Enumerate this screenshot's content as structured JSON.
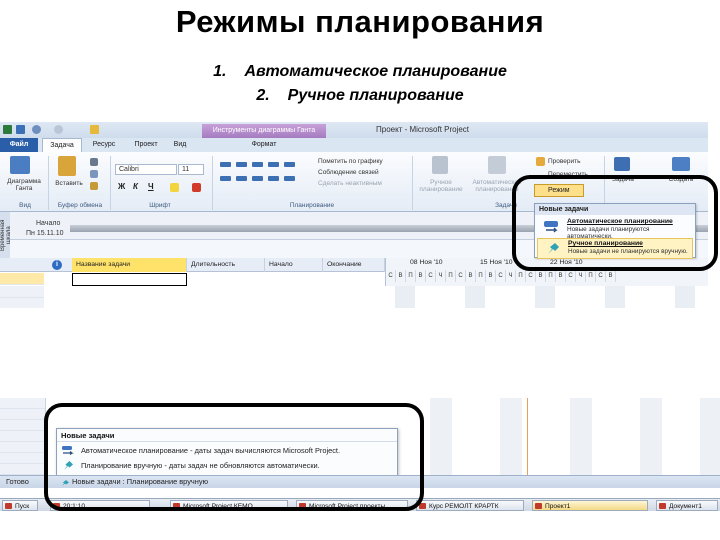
{
  "slide": {
    "title": "Режимы планирования",
    "items": [
      {
        "num": "1.",
        "text": "Автоматическое планирование"
      },
      {
        "num": "2.",
        "text": "Ручное планирование"
      }
    ]
  },
  "app": {
    "window_title": "Проект - Microsoft Project",
    "context_tab": "Инструменты диаграммы Ганта",
    "tabs": [
      "Файл",
      "Задача",
      "Ресурс",
      "Проект",
      "Вид",
      "Формат"
    ],
    "active_tab": "Задача"
  },
  "ribbon": {
    "gantt_label": "Диаграмма Ганта",
    "paste_label": "Вставить",
    "font_name": "Calibri",
    "font_size": "11",
    "bold": "Ж",
    "italic": "К",
    "underline": "Ч",
    "mark_on_track": "Пометить по графику",
    "respect_links": "Соблюдение связей",
    "make_inactive": "Сделать неактивным",
    "manual_schedule": "Ручное планирование",
    "auto_schedule": "Автоматическое планирование",
    "inspect": "Проверить",
    "move": "Переместить",
    "mode": "Режим",
    "task": "Задача",
    "create": "Создать",
    "groups": {
      "view": "Вид",
      "clipboard": "Буфер обмена",
      "font": "Шрифт",
      "schedule": "Планирование",
      "tasks": "Задачи"
    }
  },
  "timeline": {
    "side_label": "Временная шкала",
    "start_label": "Начало",
    "start_date": "Пн 15.11.10"
  },
  "grid": {
    "columns": [
      "Название задачи",
      "Длительность",
      "Начало",
      "Окончание"
    ],
    "weeks": [
      "08 Ноя '10",
      "15 Ноя '10",
      "22 Ноя '10"
    ],
    "days": [
      "С",
      "В",
      "П",
      "В",
      "С",
      "Ч",
      "П",
      "С",
      "В",
      "П",
      "В",
      "С",
      "Ч",
      "П",
      "С",
      "В",
      "П",
      "В",
      "С",
      "Ч",
      "П",
      "С",
      "В"
    ]
  },
  "mode_dropdown": {
    "header": "Новые задачи",
    "items": [
      {
        "title": "Автоматическое планирование",
        "desc": "Новые задачи планируются автоматически."
      },
      {
        "title": "Ручное планирование",
        "desc": "Новые задачи не планируются вручную."
      }
    ]
  },
  "tooltip": {
    "header": "Новые задачи",
    "rows": [
      "Автоматическое планирование - даты задач вычисляются Microsoft Project.",
      "Планирование вручную - даты задач не обновляются автоматически."
    ]
  },
  "status_bar": {
    "ready": "Готово",
    "new_tasks_mode": "Новые задачи : Планирование вручную"
  },
  "taskbar": {
    "items": [
      "Пуск",
      "20:1:10",
      "Microsoft Project КЕМО",
      "Microsoft Project проекты",
      "Курс РЕМОЛТ КРАРТК",
      "Проект1",
      "Документ1"
    ]
  }
}
